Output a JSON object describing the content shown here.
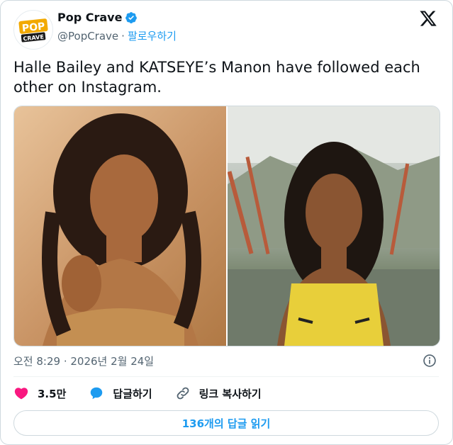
{
  "author": {
    "display_name": "Pop Crave",
    "handle": "@PopCrave",
    "separator": "·",
    "follow_label": "팔로우하기",
    "verified": true,
    "avatar_text_top": "POP",
    "avatar_text_bottom": "CRAVE"
  },
  "tweet": {
    "text": "Halle Bailey and KATSEYE’s Manon have followed each other on Instagram.",
    "media": [
      {
        "alt": "photo-halle-bailey"
      },
      {
        "alt": "photo-manon"
      }
    ],
    "timestamp": "오전 8:29 · 2026년 2월 24일"
  },
  "actions": {
    "likes": "3.5만",
    "reply_label": "답글하기",
    "copy_link_label": "링크 복사하기"
  },
  "read_replies_label": "136개의 답글 읽기",
  "colors": {
    "accent": "#1d9bf0",
    "like": "#f91880",
    "text": "#0f1419",
    "muted": "#536471",
    "avatar_brand": "#f2a900"
  },
  "icons": [
    "verified-badge-icon",
    "x-logo-icon",
    "info-icon",
    "heart-icon",
    "reply-bubble-icon",
    "link-icon"
  ]
}
